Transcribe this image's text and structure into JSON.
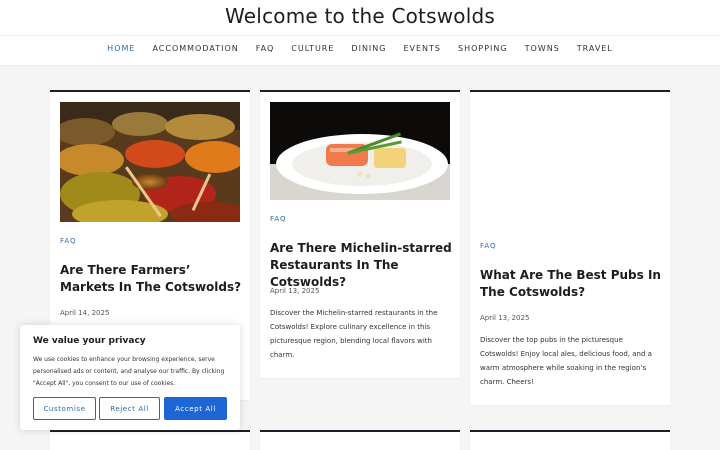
{
  "site": {
    "title": "Welcome to the Cotswolds"
  },
  "nav": {
    "items": [
      {
        "label": "HOME"
      },
      {
        "label": "ACCOMMODATION"
      },
      {
        "label": "FAQ"
      },
      {
        "label": "CULTURE"
      },
      {
        "label": "DINING"
      },
      {
        "label": "EVENTS"
      },
      {
        "label": "SHOPPING"
      },
      {
        "label": "TOWNS"
      },
      {
        "label": "TRAVEL"
      }
    ],
    "active": "HOME"
  },
  "posts": [
    {
      "category": "FAQ",
      "title": "Are There Farmers’ Markets In The Cotswolds?",
      "date": "April 14, 2025",
      "excerpt": "",
      "image": "market-spices-image"
    },
    {
      "category": "FAQ",
      "title": "Are There Michelin-starred Restaurants In The Cotswolds?",
      "date": "April 13, 2025",
      "excerpt": "Discover the Michelin-starred restaurants in the Cotswolds! Explore culinary excellence in this picturesque region, blending local flavors with charm.",
      "image": "salmon-dish-image"
    },
    {
      "category": "FAQ",
      "title": "What Are The Best Pubs In The Cotswolds?",
      "date": "April 13, 2025",
      "excerpt": "Discover the top pubs in the picturesque Cotswolds! Enjoy local ales, delicious food, and a warm atmosphere while soaking in the region’s charm. Cheers!",
      "image": ""
    }
  ],
  "cookie_banner": {
    "title": "We value your privacy",
    "text": "We use cookies to enhance your browsing experience, serve personalised ads or content, and analyse our traffic. By clicking \"Accept All\", you consent to our use of cookies.",
    "customise_label": "Customise",
    "reject_label": "Reject All",
    "accept_label": "Accept All"
  },
  "colors": {
    "accent": "#2e6aa8",
    "accept_button": "#1d66d6",
    "card_border": "#1e1e2a",
    "background": "#f5f5f5"
  }
}
